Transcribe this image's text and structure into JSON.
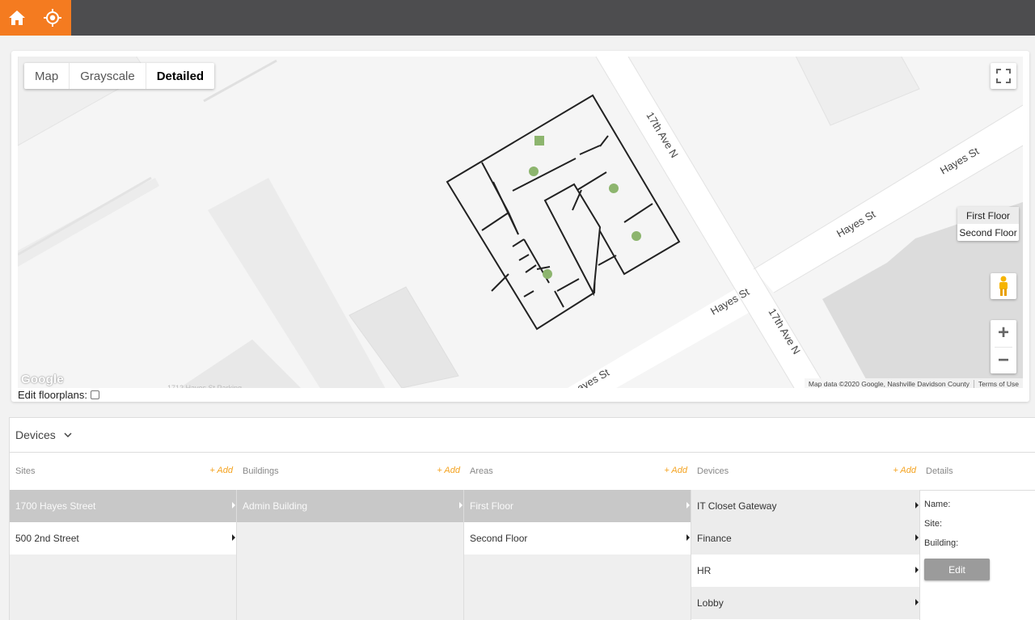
{
  "header": {
    "home_icon": "home-icon",
    "locate_icon": "crosshair-icon",
    "accent_color": "#f47b20",
    "bar_color": "#4d4d4f"
  },
  "map": {
    "map_types": [
      {
        "label": "Map",
        "active": false
      },
      {
        "label": "Grayscale",
        "active": false
      },
      {
        "label": "Detailed",
        "active": true
      }
    ],
    "streets": {
      "avenue_north": "17th Ave N",
      "avenue_south": "17th Ave N",
      "hayes_east": "Hayes St",
      "hayes_mid": "Hayes St",
      "hayes_center": "Hayes St",
      "hayes_south": "ayes St"
    },
    "floors": [
      {
        "label": "First Floor",
        "active": true
      },
      {
        "label": "Second Floor",
        "active": false
      }
    ],
    "google_logo": "Google",
    "attribution": "Map data ©2020 Google, Nashville Davidson County",
    "terms": "Terms of Use",
    "edit_floorplans_label": "Edit floorplans:",
    "device_marker_color": "#8db56e"
  },
  "devices": {
    "title": "Devices",
    "add_label": "+ Add",
    "columns": {
      "sites": {
        "header": "Sites",
        "items": [
          "1700 Hayes Street",
          "500 2nd Street"
        ]
      },
      "buildings": {
        "header": "Buildings",
        "items": [
          "Admin Building"
        ]
      },
      "areas": {
        "header": "Areas",
        "items": [
          "First Floor",
          "Second Floor"
        ]
      },
      "devices": {
        "header": "Devices",
        "items": [
          "IT Closet Gateway",
          "Finance",
          "HR",
          "Lobby"
        ]
      }
    },
    "details": {
      "header": "Details",
      "name_label": "Name:",
      "site_label": "Site:",
      "building_label": "Building:",
      "edit_label": "Edit"
    }
  }
}
